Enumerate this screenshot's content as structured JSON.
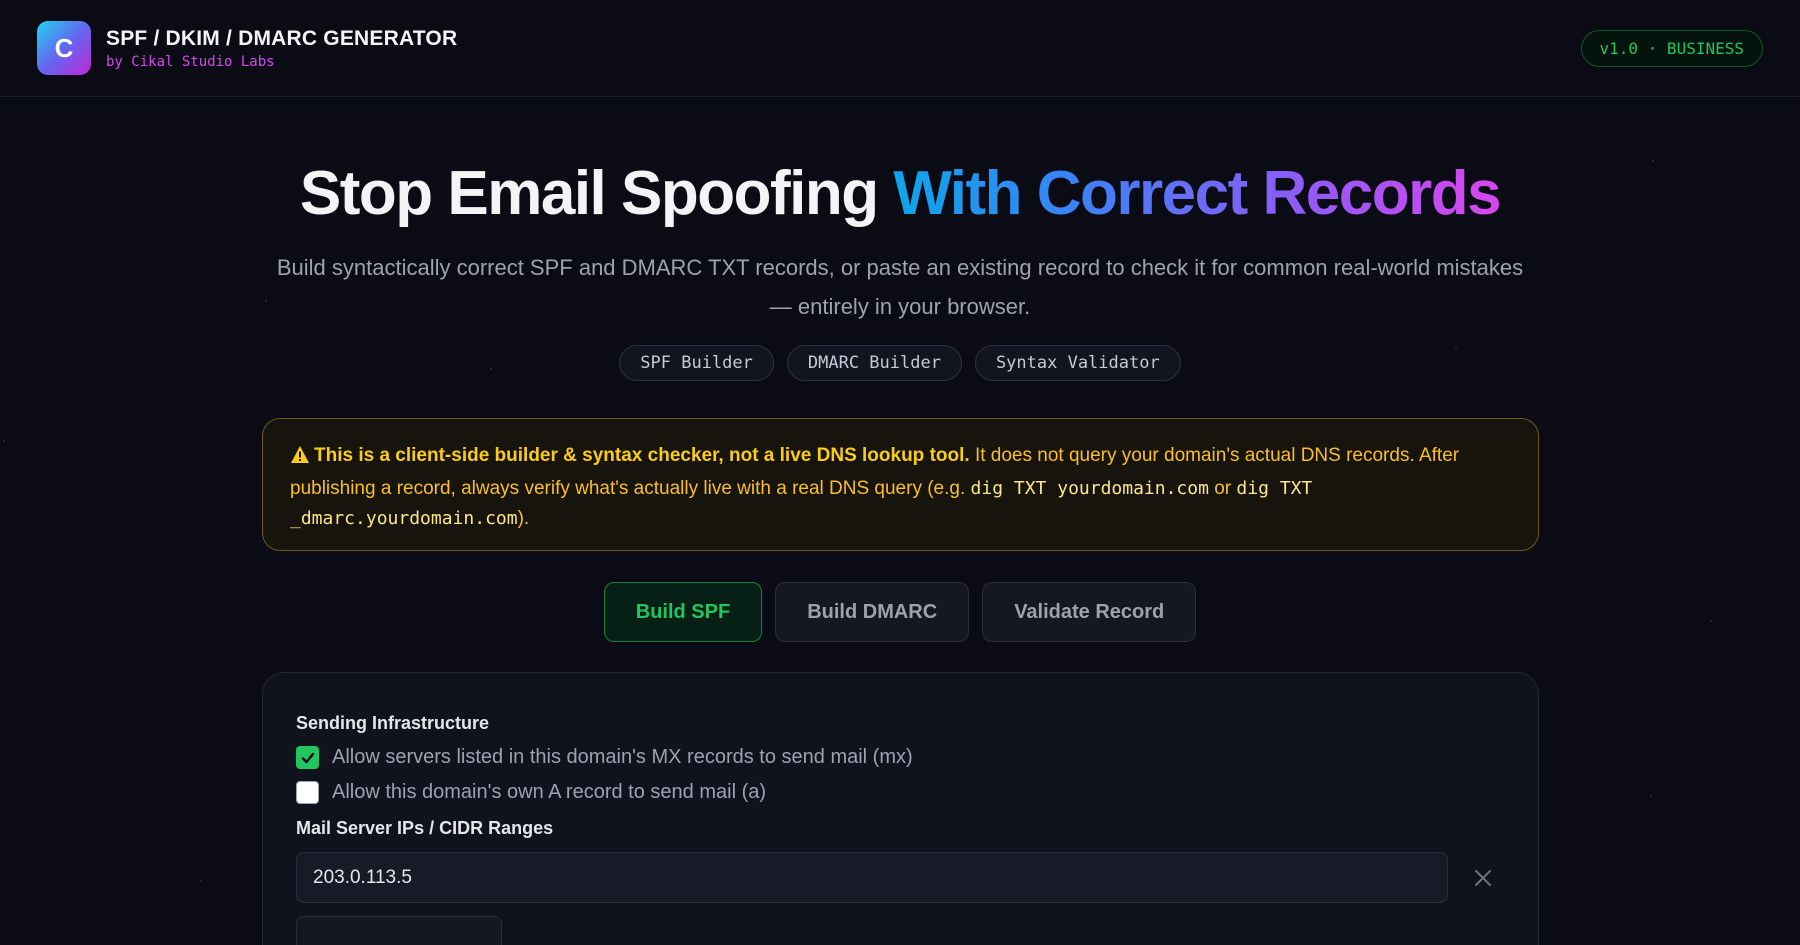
{
  "header": {
    "logo_letter": "C",
    "title": "SPF / DKIM / DMARC GENERATOR",
    "subtitle": "by Cikal Studio Labs",
    "version_badge": "v1.0 · BUSINESS"
  },
  "hero": {
    "title_plain": "Stop Email Spoofing",
    "title_highlight": "With Correct Records",
    "description": "Build syntactically correct SPF and DMARC TXT records, or paste an existing record to check it for common real-world mistakes — entirely in your browser.",
    "chips": [
      "SPF Builder",
      "DMARC Builder",
      "Syntax Validator"
    ]
  },
  "warning": {
    "bold": "This is a client-side builder & syntax checker, not a live DNS lookup tool.",
    "text1": " It does not query your domain's actual DNS records. After publishing a record, always verify what's actually live with a real DNS query (e.g. ",
    "code1": "dig TXT yourdomain.com",
    "text2": " or ",
    "code2": "dig TXT _dmarc.yourdomain.com",
    "text3": ")."
  },
  "tabs": [
    {
      "label": "Build SPF",
      "active": true
    },
    {
      "label": "Build DMARC",
      "active": false
    },
    {
      "label": "Validate Record",
      "active": false
    }
  ],
  "spf": {
    "section_label": "Sending Infrastructure",
    "options": [
      {
        "label": "Allow servers listed in this domain's MX records to send mail (mx)",
        "checked": true
      },
      {
        "label": "Allow this domain's own A record to send mail (a)",
        "checked": false
      }
    ],
    "ip_label": "Mail Server IPs / CIDR Ranges",
    "ip_values": [
      "203.0.113.5"
    ]
  },
  "colors": {
    "accent_green": "#22c55e",
    "warning_yellow": "#facc15",
    "brand_magenta": "#d946ef",
    "background": "#0a0b14"
  },
  "icons": {
    "logo": "cikal-logo-icon",
    "warning": "warning-triangle-icon",
    "check": "check-icon",
    "remove": "close-icon"
  }
}
